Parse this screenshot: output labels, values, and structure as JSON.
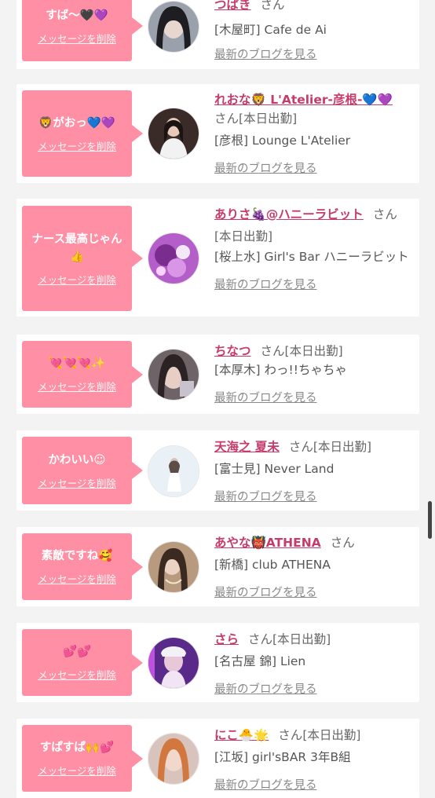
{
  "delete_label": "メッセージを削除",
  "blog_label": "最新のブログを見る",
  "san_label": "さん",
  "accent": "#ff8fa5",
  "name_color": "#c63b6b",
  "cards": [
    {
      "message": "すば〜🖤💜",
      "name": "つばき",
      "shift": "",
      "shop": "[木屋町] Cafe de Ai",
      "avatar": "dark-haired woman avatar"
    },
    {
      "message": "🦁がおっ💙💜",
      "name": "れおな🦁 L'Atelier-彦根-💙💜",
      "shift": "[本日出勤]",
      "shop": "[彦根] Lounge L'Atelier",
      "avatar": "woman in white dress avatar"
    },
    {
      "message": "ナース最高じゃん👍",
      "name": "ありさ🍇@ハニーラビット",
      "shift": "[本日出勤]",
      "shop": "[桜上水] Girl's Bar ハニーラビット",
      "avatar": "purple neon avatar"
    },
    {
      "message": "💘💘💘✨",
      "name": "ちなつ",
      "shift": "[本日出勤]",
      "shop": "[本厚木] わっ!!ちゃちゃ",
      "avatar": "selfie avatar"
    },
    {
      "message": "かわいい☺",
      "name": "天海之 夏未",
      "shift": "[本日出勤]",
      "shop": "[富士見] Never Land",
      "avatar": "woman in white gown avatar"
    },
    {
      "message": "素敵ですね🥰",
      "name": "あやな👹ATHENA",
      "shift": "",
      "shop": "[新橋] club ATHENA",
      "avatar": "woman with necklace avatar"
    },
    {
      "message": "💕💕",
      "name": "さら",
      "shift": "[本日出勤]",
      "shop": "[名古屋 錦] Lien",
      "avatar": "nurse costume avatar"
    },
    {
      "message": "すぱすぱ🙌💕",
      "name": "にこ🐣🌟",
      "shift": "[本日出勤]",
      "shop": "[江坂] girl'sBAR 3年B組",
      "avatar": "orange-haired woman avatar"
    }
  ]
}
